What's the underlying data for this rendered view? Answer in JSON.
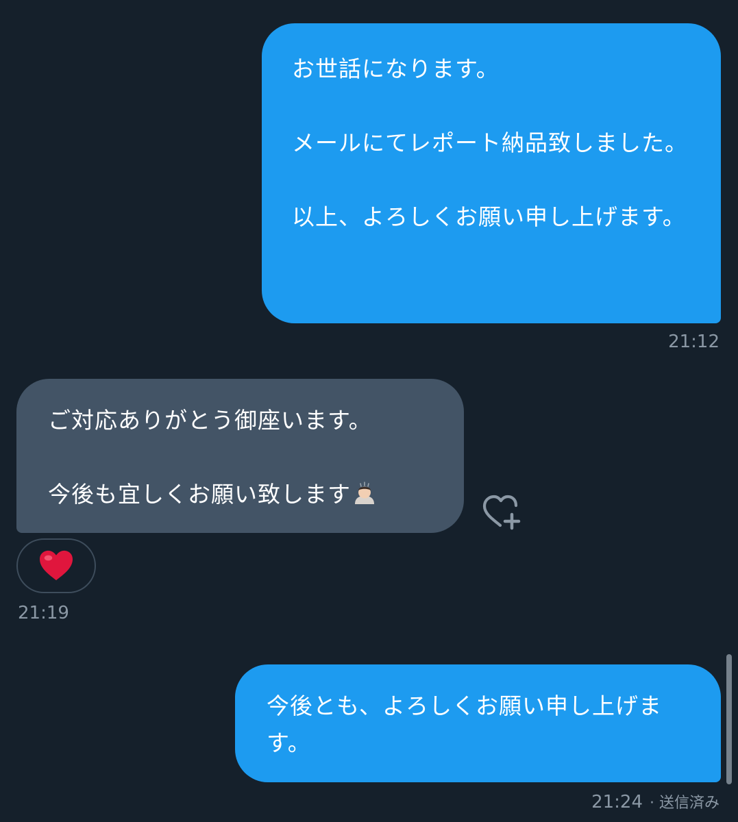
{
  "conversation": {
    "messages": [
      {
        "direction": "sent",
        "text": "お世話になります。\n\nメールにてレポート納品致しました。\n\n以上、よろしくお願い申し上げます。",
        "time": "21:12"
      },
      {
        "direction": "received",
        "text": "ご対応ありがとう御座います。\n\n今後も宜しくお願い致します",
        "emoji": "person-bowing-emoji",
        "time": "21:19",
        "reaction": "heart-emoji"
      },
      {
        "direction": "sent",
        "text": "今後とも、よろしくお願い申し上げます。",
        "time": "21:24",
        "status": "· 送信済み"
      }
    ]
  },
  "colors": {
    "background": "#15202b",
    "sent_bubble": "#1d9bf0",
    "received_bubble": "#435466",
    "timestamp": "#8b98a5",
    "heart": "#e0163d"
  },
  "icons": {
    "add_reaction": "heart-plus-icon",
    "reaction": "heart-emoji"
  }
}
